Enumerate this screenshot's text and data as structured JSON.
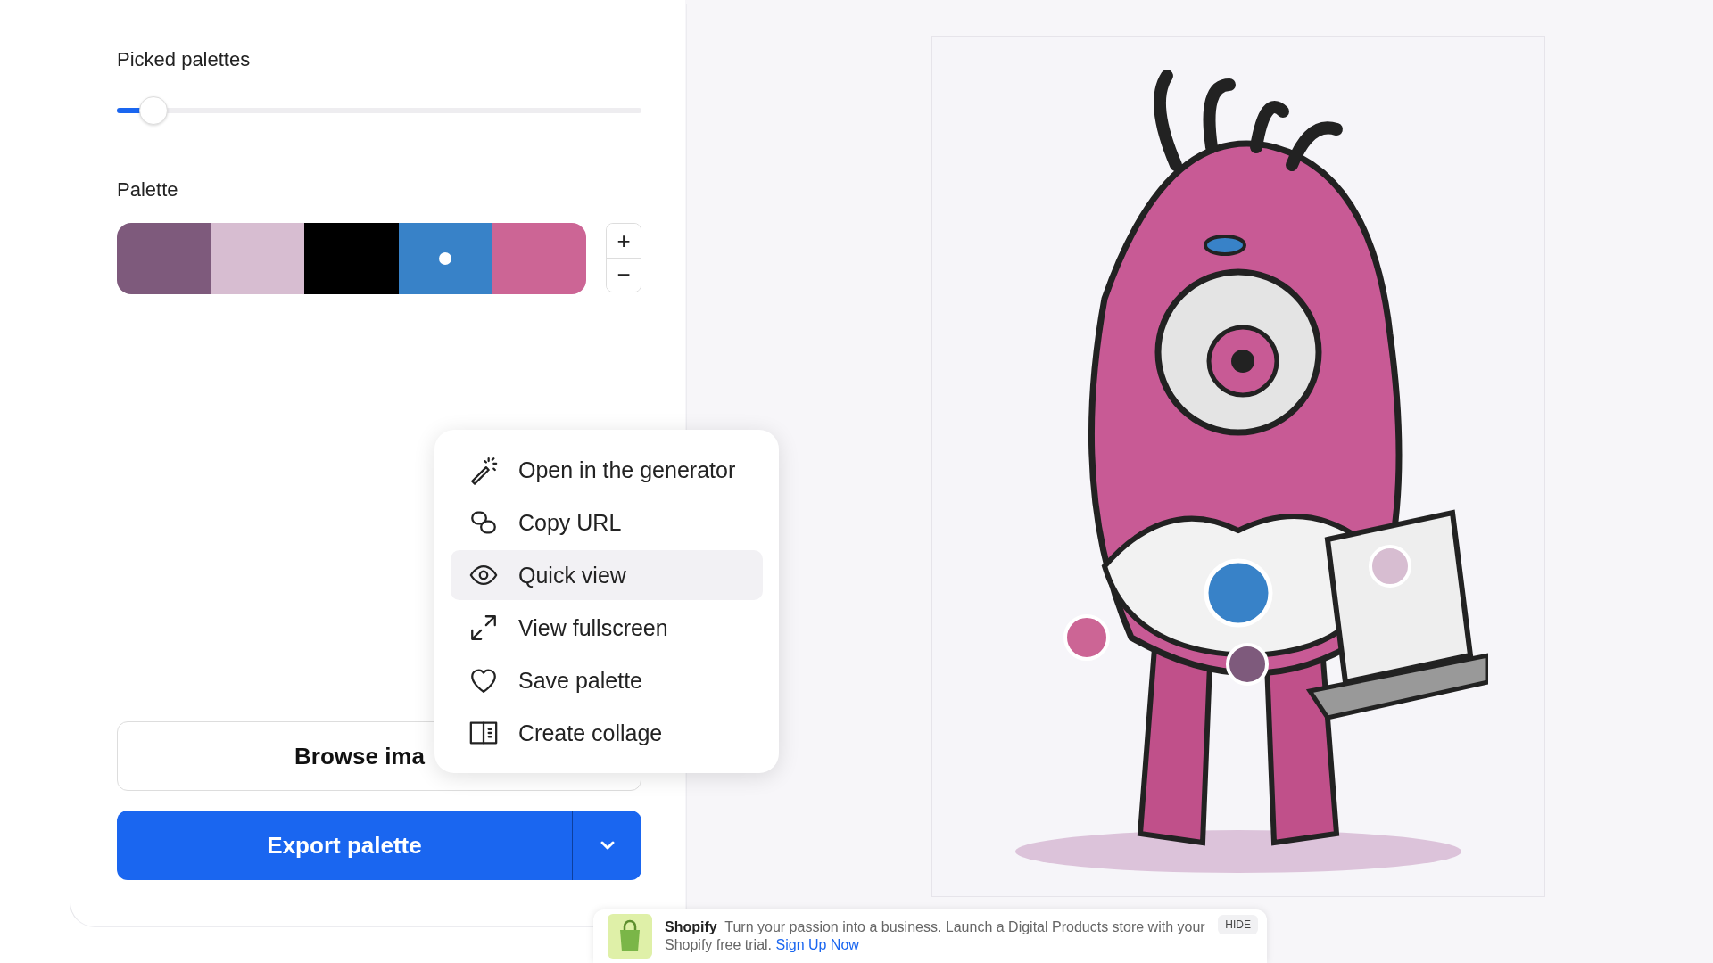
{
  "picked_palettes": {
    "label": "Picked palettes",
    "level": 0.07
  },
  "palette": {
    "label": "Palette",
    "swatches": [
      {
        "color": "#7e5a7c",
        "selected": false
      },
      {
        "color": "#d7bdd1",
        "selected": false
      },
      {
        "color": "#000000",
        "selected": false
      },
      {
        "color": "#3882c8",
        "selected": true
      },
      {
        "color": "#cc6595",
        "selected": false
      }
    ],
    "add": "+",
    "remove": "−"
  },
  "browse_button": "Browse ima",
  "export_button": "Export palette",
  "menu": [
    {
      "kind": "wand",
      "label": "Open in the generator",
      "selected": false
    },
    {
      "kind": "link",
      "label": "Copy URL",
      "selected": false
    },
    {
      "kind": "eye",
      "label": "Quick view",
      "selected": true
    },
    {
      "kind": "expand",
      "label": "View fullscreen",
      "selected": false
    },
    {
      "kind": "heart",
      "label": "Save palette",
      "selected": false
    },
    {
      "kind": "collage",
      "label": "Create collage",
      "selected": false
    }
  ],
  "ad": {
    "brand": "Shopify",
    "text": "Turn your passion into a business. Launch a Digital Products store with your Shopify free trial.",
    "link": "Sign Up Now",
    "hide": "HIDE"
  }
}
